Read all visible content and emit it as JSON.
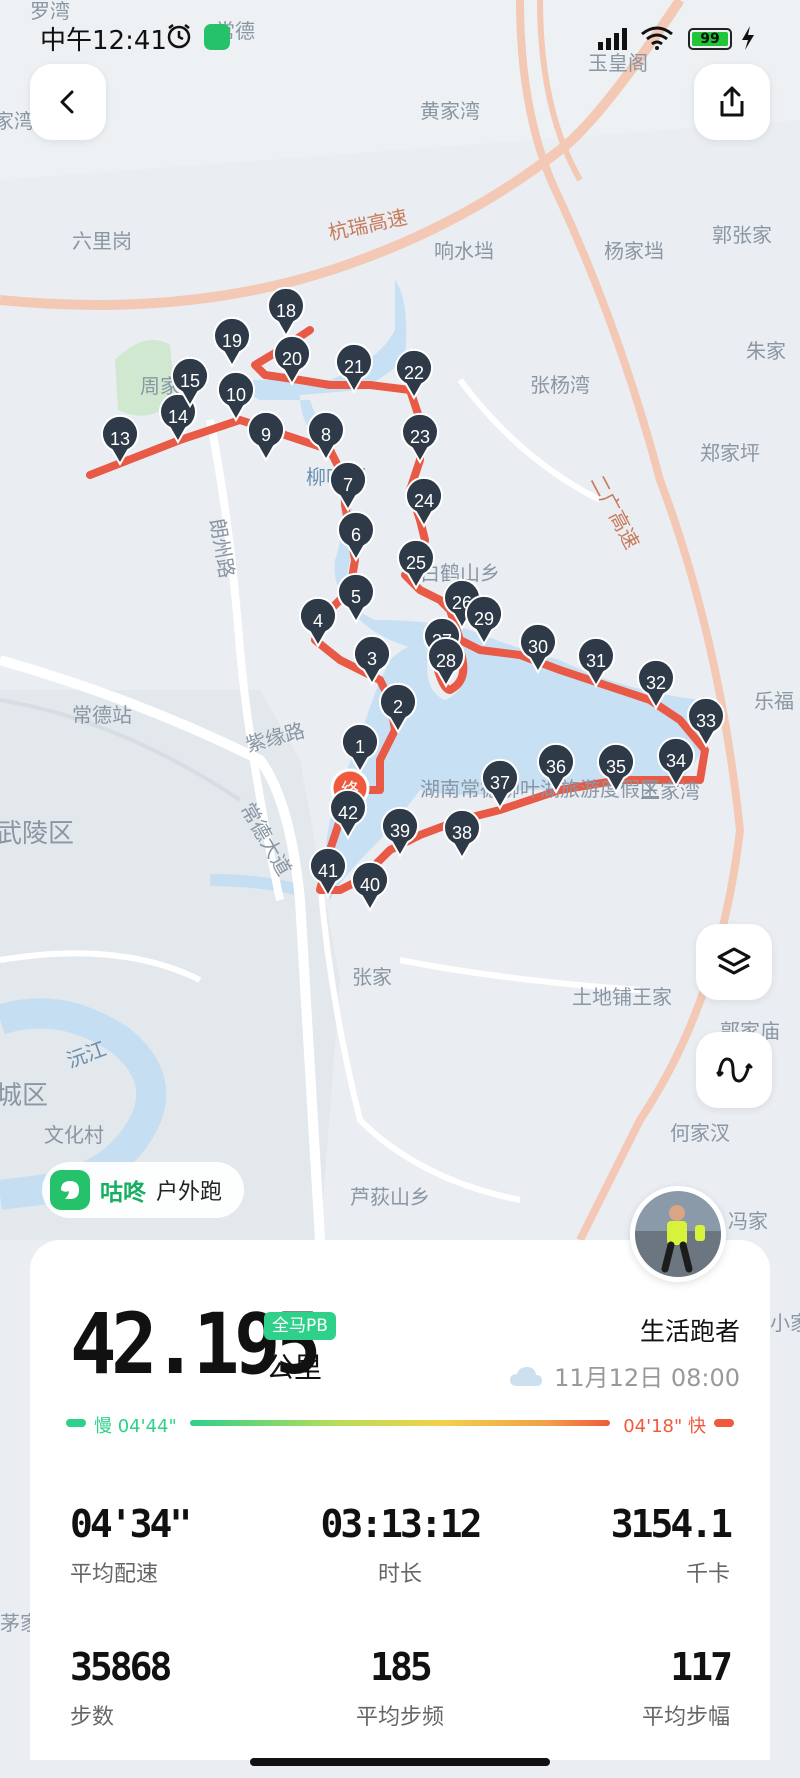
{
  "status_bar": {
    "time": "中午12:41",
    "battery": "99",
    "icons": [
      "alarm-icon",
      "app-notification-icon",
      "signal-icon",
      "wifi-icon",
      "battery-icon",
      "charging-icon"
    ]
  },
  "map": {
    "labels": {
      "luo_wan": "罗湾",
      "chang_de_top": "常德",
      "yu_huang_ge": "玉皇阁",
      "jia_jia": "家湾",
      "huang_jia_wan": "黄家湾",
      "hang_rui": "杭瑞高速",
      "liu_li_gang": "六里岗",
      "xiang_shui_dang": "响水垱",
      "yang_jia_dang": "杨家垱",
      "guo_zhang_jia": "郭张家",
      "zhu_jia": "朱家",
      "zhou_jia": "周家",
      "zhang_yang_wan": "张杨湾",
      "zheng_jia_ping": "郑家坪",
      "liu_lake": "柳叶湖",
      "lang_zhou_lu": "朗州路",
      "er_guang": "二广高速",
      "bai_he_shan": "白鹤山乡",
      "le_fu": "乐福",
      "chang_de_zhan": "常德站",
      "zi_yuan_lu": "紫缘路",
      "wu_ling_qu": "武陵区",
      "resort": "湖南常德柳叶湖旅游度假区",
      "chang_de_da_dao": "常德大道",
      "wang_jia_wan": "王家湾",
      "zhang_jia": "张家",
      "tu_di_pu": "土地铺王家",
      "guo_jia_miao": "郭家庙",
      "yuan_jiang": "沅江",
      "cheng_qu": "城区",
      "wen_hua_cun": "文化村",
      "he_jia_han": "何家汊",
      "lu_di_shan": "芦荻山乡",
      "feng_jia": "冯家",
      "xiao_jia": "小家",
      "mao_jia": "茅家",
      "finish_marker": "终"
    },
    "km_markers": [
      "1",
      "2",
      "3",
      "4",
      "5",
      "6",
      "7",
      "8",
      "9",
      "10",
      "13",
      "14",
      "15",
      "18",
      "19",
      "20",
      "21",
      "22",
      "23",
      "24",
      "25",
      "26",
      "27",
      "28",
      "29",
      "30",
      "31",
      "32",
      "33",
      "34",
      "35",
      "36",
      "37",
      "38",
      "39",
      "40",
      "41",
      "42"
    ],
    "route_color": "#e85a45"
  },
  "controls": {
    "back": "chevron-left-icon",
    "share": "share-icon",
    "layers": "layers-icon",
    "route": "route-icon"
  },
  "brand": {
    "name": "咕咚",
    "mode": "户外跑"
  },
  "summary": {
    "distance": "42.195",
    "pb_badge": "全马PB",
    "unit": "公里",
    "runner_name": "生活跑者",
    "date_time": "11月12日 08:00",
    "weather_icon": "cloud-icon",
    "pace_slow_label": "慢 04'44\"",
    "pace_fast_label": "04'18\" 快"
  },
  "stats": [
    {
      "value": "04'34\"",
      "label": "平均配速"
    },
    {
      "value": "03:13:12",
      "label": "时长"
    },
    {
      "value": "3154.1",
      "label": "千卡"
    },
    {
      "value": "35868",
      "label": "步数"
    },
    {
      "value": "185",
      "label": "平均步频"
    },
    {
      "value": "117",
      "label": "平均步幅"
    }
  ]
}
